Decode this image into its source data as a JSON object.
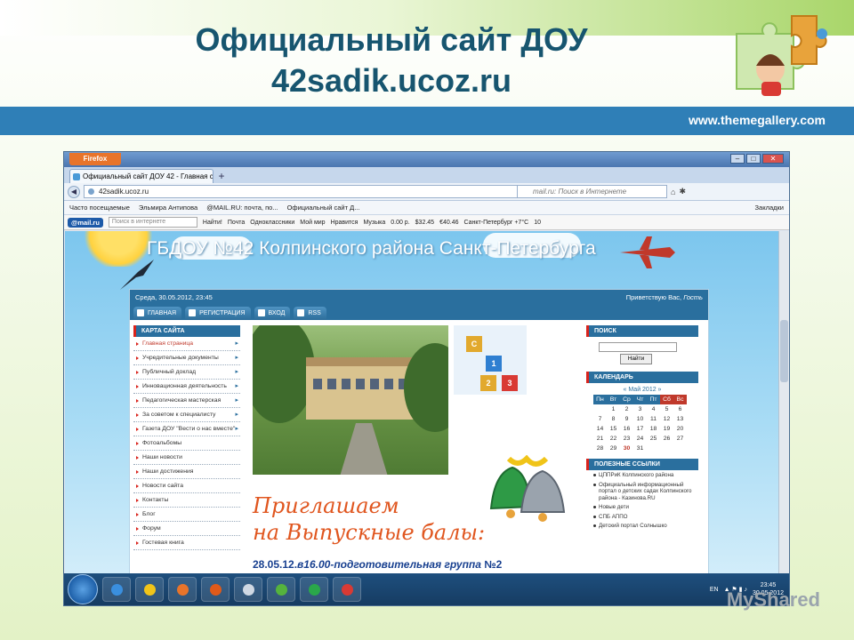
{
  "slide": {
    "title_line1": "Официальный сайт ДОУ",
    "title_line2": "42sadik.ucoz.ru",
    "url": "www.themegallery.com",
    "watermark": "MyShared",
    "colors": {
      "stripe": "#2f7fb7",
      "title": "#17556f",
      "accent_green": "#a9d66a"
    }
  },
  "browser": {
    "app_button": "Firefox",
    "tab_title": "Официальный сайт ДОУ 42 - Главная с...",
    "new_tab": "+",
    "url": "42sadik.ucoz.ru",
    "search_placeholder": "mail.ru: Поиск в Интернете",
    "bookmarks": [
      "Часто посещаемые",
      "Эльмира Антипова",
      "@MAIL.RU: почта, по...",
      "Официальный сайт Д..."
    ],
    "bookmarks_right": "Закладки",
    "mailbar": {
      "logo": "@mail.ru",
      "search_placeholder": "Поиск в интернете",
      "find": "Найти!",
      "items": [
        "Почта",
        "Одноклассники",
        "Мой мир",
        "Нравится",
        "Музыка",
        "0.00 р.",
        "$32.45",
        "€40.46",
        "Санкт-Петербург +7°C",
        "10"
      ]
    }
  },
  "site": {
    "banner_title": "ГБДОУ №42 Колпинского района Санкт-Петербурга",
    "date": "Среда, 30.05.2012, 23:45",
    "greeting": "Приветствую Вас,",
    "greeting_user": "Гость",
    "nav": [
      "ГЛАВНАЯ",
      "РЕГИСТРАЦИЯ",
      "ВХОД",
      "RSS"
    ],
    "sitemap_title": "КАРТА САЙТА",
    "menu": [
      {
        "label": "Главная страница",
        "arrow": "▸",
        "active": true
      },
      {
        "label": "Учредительные документы",
        "arrow": "▸"
      },
      {
        "label": "Публичный доклад",
        "arrow": "▸"
      },
      {
        "label": "Инновационная деятельность",
        "arrow": "▸"
      },
      {
        "label": "Педагогическая мастерская",
        "arrow": "▸"
      },
      {
        "label": "За советом к специалисту",
        "arrow": "▸"
      },
      {
        "label": "Газета ДОУ \"Вести о нас вместе\"",
        "arrow": "▸"
      },
      {
        "label": "Фотоальбомы"
      },
      {
        "label": "Наши новости"
      },
      {
        "label": "Наши достижения"
      },
      {
        "label": "Новости сайта"
      },
      {
        "label": "Контакты"
      },
      {
        "label": "Блог"
      },
      {
        "label": "Форум"
      },
      {
        "label": "Гостевая книга"
      }
    ],
    "invite_line1": "Приглашаем",
    "invite_line2": "на Выпускные балы:",
    "grad_date": "28.05.12.",
    "grad_text": "в16.00-подготовительная группа",
    "grad_group": "№2",
    "search_title": "ПОИСК",
    "search_button": "Найти",
    "calendar_title": "КАЛЕНДАРЬ",
    "calendar_month": "« Май 2012 »",
    "calendar_days": [
      "Пн",
      "Вт",
      "Ср",
      "Чт",
      "Пт",
      "Сб",
      "Вс"
    ],
    "calendar_weeks": [
      [
        "",
        "1",
        "2",
        "3",
        "4",
        "5",
        "6"
      ],
      [
        "7",
        "8",
        "9",
        "10",
        "11",
        "12",
        "13"
      ],
      [
        "14",
        "15",
        "16",
        "17",
        "18",
        "19",
        "20"
      ],
      [
        "21",
        "22",
        "23",
        "24",
        "25",
        "26",
        "27"
      ],
      [
        "28",
        "29",
        "30",
        "31",
        "",
        "",
        ""
      ]
    ],
    "calendar_today": "30",
    "links_title": "ПОЛЕЗНЫЕ ССЫЛКИ",
    "links": [
      "ЦППРиК Колпинского района",
      "Официальный информационный портал о детских садах Колпинского района - Казинова.RU",
      "Новые дети",
      "СПБ АППО",
      "Детский портал Солнышко"
    ]
  },
  "taskbar": {
    "lang": "EN",
    "time": "23:45",
    "date": "30.05.2012"
  },
  "cube_labels": [
    "C",
    "1",
    "2",
    "3"
  ]
}
